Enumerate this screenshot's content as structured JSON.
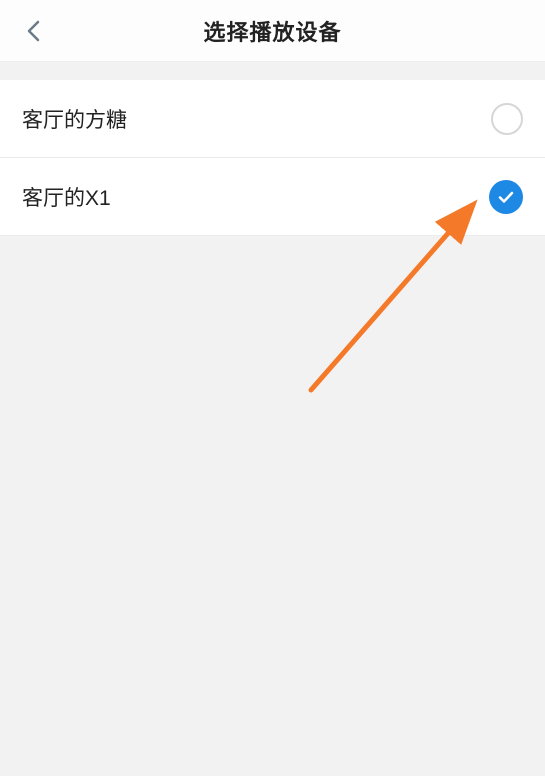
{
  "header": {
    "title": "选择播放设备"
  },
  "devices": [
    {
      "label": "客厅的方糖",
      "selected": false
    },
    {
      "label": "客厅的X1",
      "selected": true
    }
  ],
  "colors": {
    "accent": "#1e88e5",
    "annotation": "#f47a2a"
  }
}
